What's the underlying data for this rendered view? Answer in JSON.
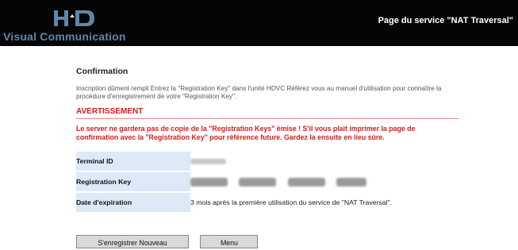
{
  "header": {
    "logo_text": "Visual Communication",
    "service_title": "Page du service \"NAT Traversal\""
  },
  "confirmation": {
    "title": "Confirmation",
    "description": "Inscription dûment rempli Entrez la \"Registration Key\" dans l'unité HDVC Référez vous au manuel d'utilisation pour connaître la procédure d'enregistrement de votre \"Registration Key\"."
  },
  "warning": {
    "title": "AVERTISSEMENT",
    "text": "Le server ne gardera pas de copie de la \"Registration Keys\" émise ! S'il vous plait imprimer la page de confirmation avec la \"Registration Key\" pour référence future. Gardez la ensuite en lieu sûre."
  },
  "details": {
    "terminal_id_label": "Terminal ID",
    "registration_key_label": "Registration Key",
    "date_label": "Date d'expiration",
    "date_value": "3 mois après la première utilisation du service de \"NAT Traversal\"."
  },
  "buttons": {
    "register_new": "S'enregistrer Nouveau",
    "menu": "Menu"
  },
  "colors": {
    "header_background": "#050505",
    "warning": "#d51c1c",
    "label_background": "#dde9f9"
  }
}
